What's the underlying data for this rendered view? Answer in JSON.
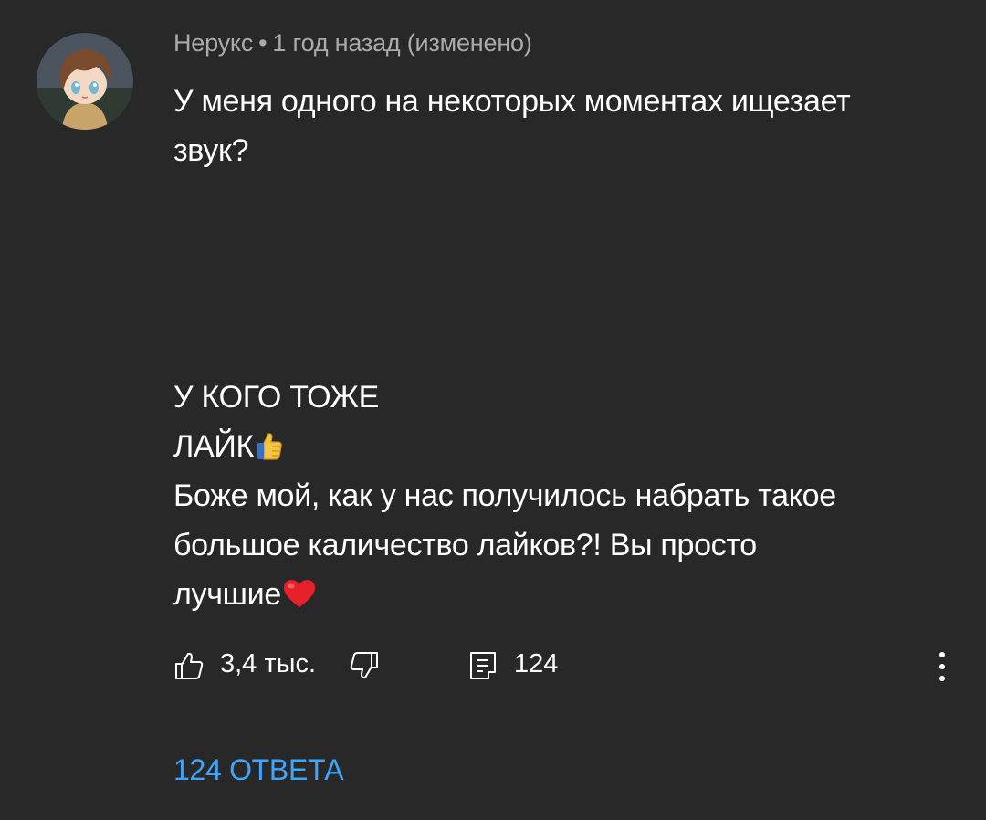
{
  "comment": {
    "author": "Нерукс",
    "separator": "•",
    "time": "1 год назад",
    "edited": "(изменено)",
    "lines": [
      "У меня одного на некоторых моментах ищезает",
      "звук?",
      "",
      "",
      "",
      "",
      "У КОГО ТОЖЕ",
      "ЛАЙК",
      "Боже мой, как у нас получилось набрать такое",
      "большое каличество лайков?! Вы просто",
      "лучшие"
    ]
  },
  "actions": {
    "like_count": "3,4 тыс.",
    "reply_count": "124"
  },
  "replies": {
    "label": "124 ОТВЕТА"
  },
  "icons": {
    "like": "thumb-up-icon",
    "dislike": "thumb-down-icon",
    "reply": "comment-icon",
    "more": "more-vertical-icon",
    "emoji_like": "thumbs-up-emoji",
    "emoji_heart": "red-heart-emoji"
  },
  "colors": {
    "background": "#282828",
    "text": "#ffffff",
    "meta": "#aaaaaa",
    "link": "#3ea6ff"
  }
}
